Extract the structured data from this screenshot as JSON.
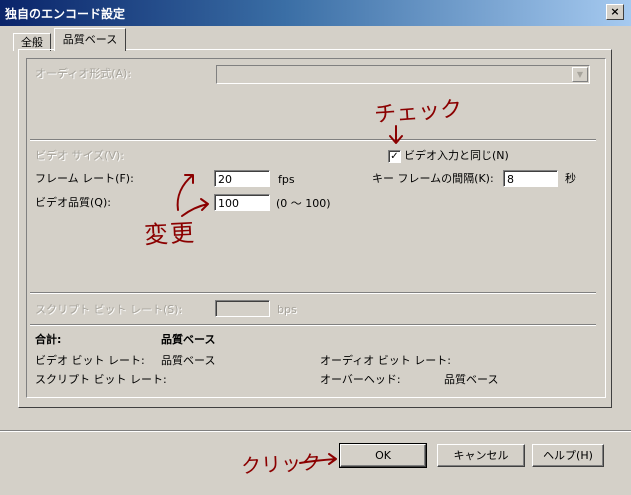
{
  "window": {
    "title": "独自のエンコード設定",
    "close_glyph": "×"
  },
  "tabs": [
    {
      "label": "全般",
      "active": false
    },
    {
      "label": "品質ベース",
      "active": true
    }
  ],
  "audio": {
    "format_label": "オーディオ形式(A):",
    "format_value": ""
  },
  "video": {
    "size_label": "ビデオ サイズ(V):",
    "same_as_input_label": "ビデオ入力と同じ(N)",
    "same_as_input_checked": true,
    "check_glyph": "✓",
    "frame_rate_label": "フレーム レート(F):",
    "frame_rate_value": "20",
    "frame_rate_unit": "fps",
    "keyframe_label": "キー フレームの間隔(K):",
    "keyframe_value": "8",
    "keyframe_unit": "秒",
    "quality_label": "ビデオ品質(Q):",
    "quality_value": "100",
    "quality_range": "(0 ～ 100)"
  },
  "script": {
    "bitrate_label": "スクリプト ビット レート(S):",
    "bitrate_value": "",
    "bitrate_unit": "bps"
  },
  "summary": {
    "total_label": "合計:",
    "total_value": "品質ベース",
    "video_bitrate_label": "ビデオ ビット レート:",
    "video_bitrate_value": "品質ベース",
    "script_bitrate_label": "スクリプト ビット レート:",
    "script_bitrate_value": "",
    "audio_bitrate_label": "オーディオ ビット レート:",
    "audio_bitrate_value": "",
    "overhead_label": "オーバーヘッド:",
    "overhead_value": "品質ベース"
  },
  "buttons": {
    "ok": "OK",
    "cancel": "キャンセル",
    "help": "ヘルプ(H)"
  },
  "annotations": {
    "check": "チェック",
    "change": "変更",
    "click": "クリック",
    "color": "#8b0000"
  }
}
